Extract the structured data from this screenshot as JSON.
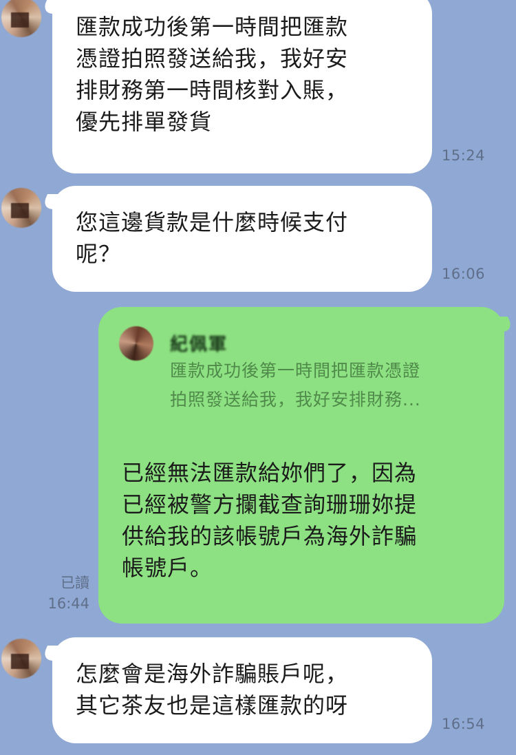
{
  "messages": [
    {
      "id": "m1",
      "direction": "incoming",
      "text": "匯款成功後第一時間把匯款\n憑證拍照發送給我，我好安\n排財務第一時間核對入賬，\n優先排單發貨",
      "time": "15:24"
    },
    {
      "id": "m2",
      "direction": "incoming",
      "text": "您這邊貨款是什麼時候支付\n呢？",
      "time": "16:06"
    },
    {
      "id": "m3",
      "direction": "outgoing",
      "quote": {
        "name": "紀佩軍",
        "text": "匯款成功後第一時間把匯款憑證\n拍照發送給我，我好安排財務..."
      },
      "text": "已經無法匯款給妳們了，因為\n已經被警方攔截查詢珊珊妳提\n供給我的該帳號戶為海外詐騙\n帳號戶。",
      "read_label": "已讀",
      "time": "16:44"
    },
    {
      "id": "m4",
      "direction": "incoming",
      "text": "怎麼會是海外詐騙賬戶呢，\n其它茶友也是這樣匯款的呀",
      "time": "16:54"
    }
  ]
}
